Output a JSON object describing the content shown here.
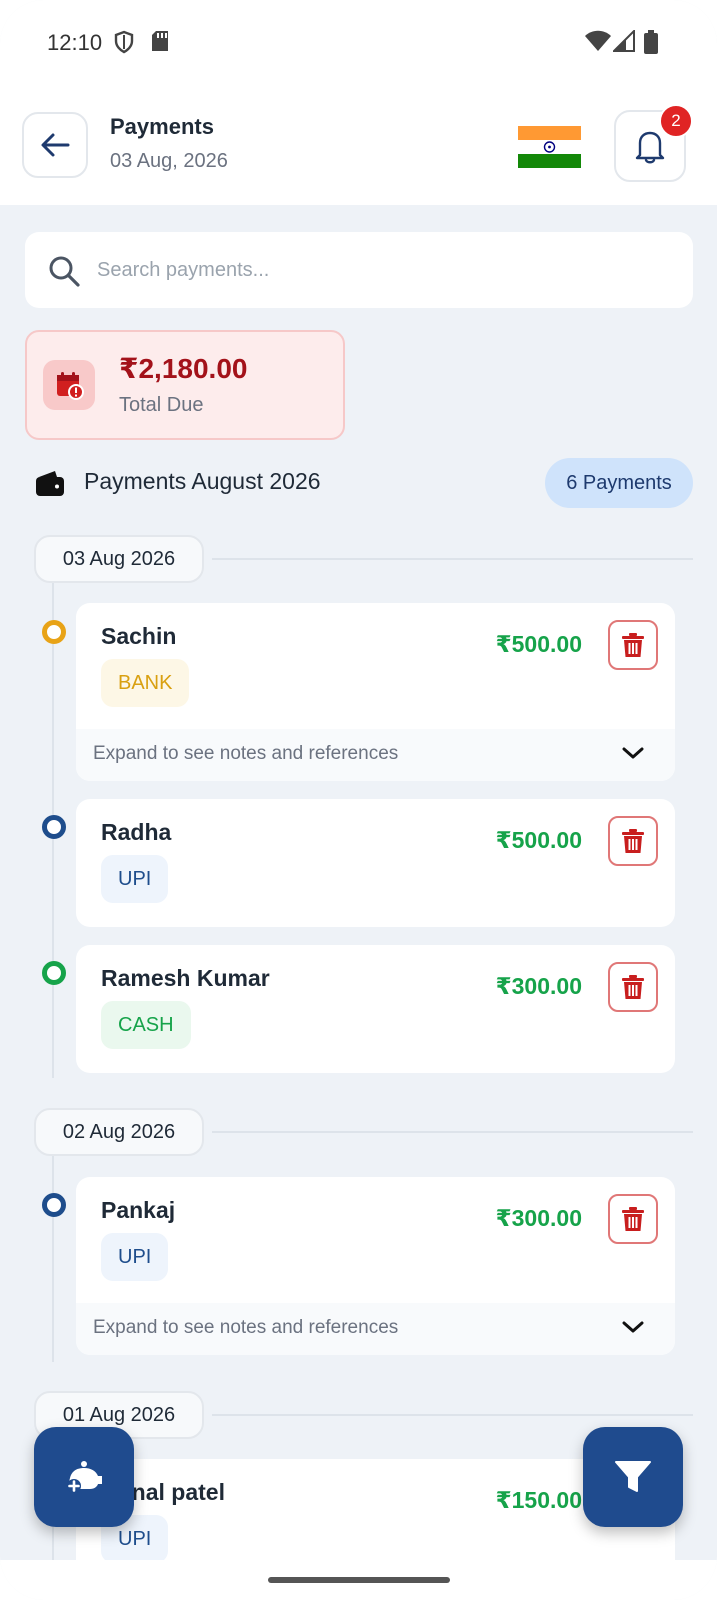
{
  "status_bar": {
    "time": "12:10"
  },
  "header": {
    "title": "Payments",
    "date": "03 Aug, 2026",
    "notification_count": "2"
  },
  "search": {
    "placeholder": "Search payments..."
  },
  "summary": {
    "amount": "₹2,180.00",
    "label": "Total Due"
  },
  "section": {
    "title": "Payments August 2026",
    "count": "6 Payments"
  },
  "colors": {
    "primary": "#1f4b8e",
    "amount_green": "#16a34a",
    "due_red": "#a3121a",
    "bank": "#d9a010",
    "upi": "#1e4d8c",
    "cash": "#16a34a"
  },
  "groups": [
    {
      "date": "03 Aug 2026",
      "payments": [
        {
          "name": "Sachin",
          "method": "BANK",
          "amount": "₹500.00",
          "expand_text": "Expand to see notes and references"
        },
        {
          "name": "Radha",
          "method": "UPI",
          "amount": "₹500.00"
        },
        {
          "name": "Ramesh Kumar",
          "method": "CASH",
          "amount": "₹300.00"
        }
      ]
    },
    {
      "date": "02 Aug 2026",
      "payments": [
        {
          "name": "Pankaj",
          "method": "UPI",
          "amount": "₹300.00",
          "expand_text": "Expand to see notes and references"
        }
      ]
    },
    {
      "date": "01 Aug 2026",
      "payments": [
        {
          "name": "Kunal patel",
          "method": "UPI",
          "amount": "₹150.00"
        }
      ]
    }
  ],
  "fabs": {
    "left_icon": "add-payment-icon",
    "right_icon": "filter-icon"
  }
}
